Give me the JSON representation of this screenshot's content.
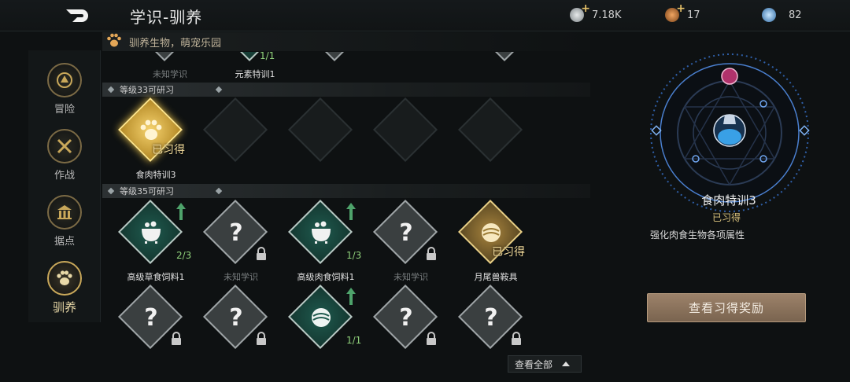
{
  "header": {
    "title": "学识-驯养",
    "resources": [
      {
        "name": "silver-coin",
        "value": "7.18K",
        "color": "#b9c0c4",
        "has_plus": true
      },
      {
        "name": "bronze-coin",
        "value": "17",
        "color": "#c27a3c",
        "has_plus": true
      },
      {
        "name": "blue-gem",
        "value": "82",
        "color": "#6aa8d8",
        "has_plus": false
      }
    ]
  },
  "sidebar": {
    "items": [
      {
        "label": "冒险",
        "icon": "adventure-icon"
      },
      {
        "label": "作战",
        "icon": "combat-icon"
      },
      {
        "label": "据点",
        "icon": "stronghold-icon"
      },
      {
        "label": "驯养",
        "icon": "paw-icon",
        "active": true
      }
    ]
  },
  "subheader": {
    "text": "驯养生物，萌宠乐园"
  },
  "tree": {
    "top_partial": [
      {
        "label": "未知学识",
        "count": ""
      },
      {
        "label": "元素特训1",
        "count": "1/1"
      }
    ],
    "level33": {
      "label": "等级33可研习"
    },
    "level33_nodes": [
      {
        "label": "食肉特训3",
        "status": "已习得"
      }
    ],
    "level35": {
      "label": "等级35可研习"
    },
    "level35_nodes": [
      {
        "label": "高级草食饲料1",
        "count": "2/3"
      },
      {
        "label": "未知学识",
        "count": ""
      },
      {
        "label": "高级肉食饲料1",
        "count": "1/3"
      },
      {
        "label": "未知学识",
        "count": ""
      },
      {
        "label": "月尾兽鞍具",
        "status": "已习得"
      }
    ],
    "row4_nodes": [
      {
        "count": ""
      },
      {
        "count": ""
      },
      {
        "count": "1/1"
      },
      {
        "count": ""
      },
      {
        "count": ""
      }
    ],
    "unknown_glyph": "?"
  },
  "detail": {
    "name": "食肉特训3",
    "status": "已习得",
    "description": "强化肉食生物各项属性",
    "reward_button": "查看习得奖励"
  },
  "footer": {
    "view_all": "查看全部"
  },
  "colors": {
    "accent_gold": "#e7c14a",
    "teal": "#1f5a4e",
    "progress_green": "#8fd07a"
  }
}
